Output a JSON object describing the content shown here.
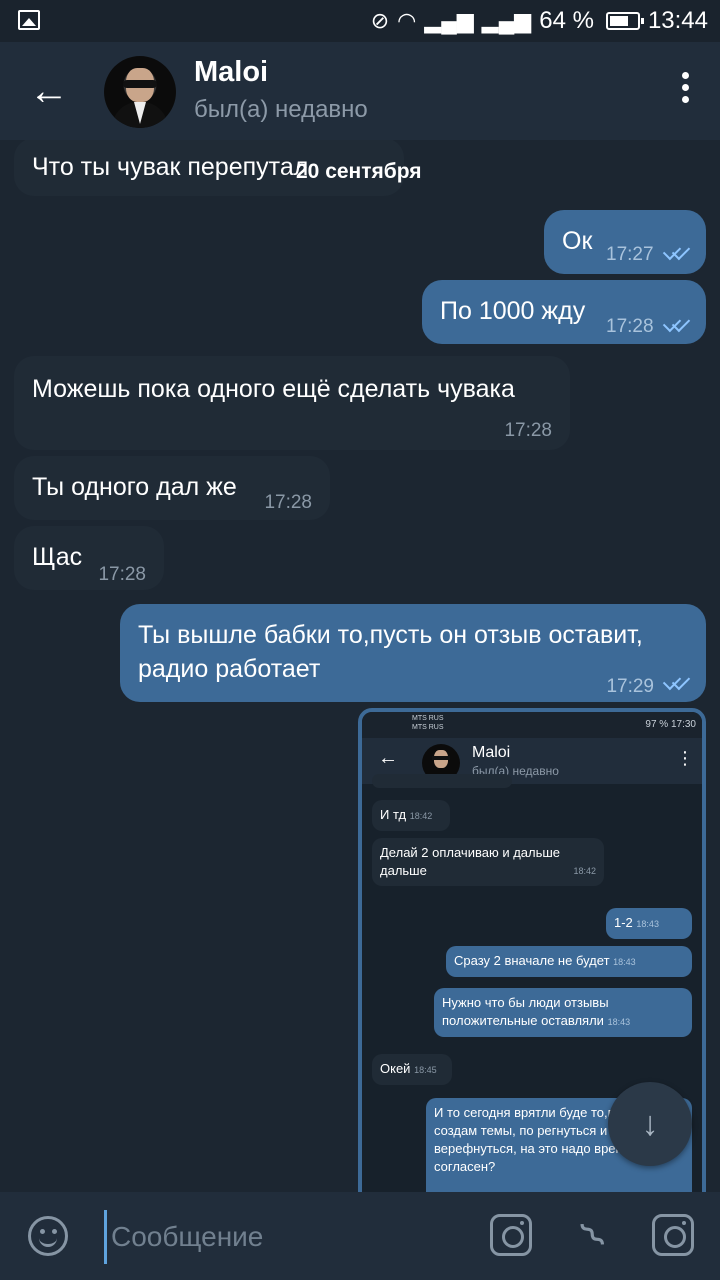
{
  "status_bar": {
    "battery": "64 %",
    "time": "13:44"
  },
  "header": {
    "title": "Maloi",
    "status": "был(а) недавно"
  },
  "date_separator": "20 сентября",
  "messages": [
    {
      "dir": "in",
      "text": "Что ты чувак перепутал",
      "time": ""
    },
    {
      "dir": "out",
      "text": "Ок",
      "time": "17:27"
    },
    {
      "dir": "out",
      "text": "По 1000 жду",
      "time": "17:28"
    },
    {
      "dir": "in",
      "text": "Можешь пока одного ещё сделать чувака",
      "time": "17:28"
    },
    {
      "dir": "in",
      "text": "Ты одного дал же",
      "time": "17:28"
    },
    {
      "dir": "in",
      "text": "Щас",
      "time": "17:28"
    },
    {
      "dir": "out",
      "text": "Ты вышле бабки то,пусть он отзыв оставит, радио работает",
      "time": "17:29"
    }
  ],
  "photo": {
    "status_left": "MTS RUS\nMTS RUS",
    "status_right": "97 % 17:30",
    "title": "Maloi",
    "status": "был(а) недавно",
    "messages": [
      {
        "dir": "in",
        "text": "И тд",
        "time": "18:42"
      },
      {
        "dir": "in",
        "text": "Делай 2 оплачиваю и дальше дальше",
        "time": "18:42"
      },
      {
        "dir": "out",
        "text": "1-2",
        "time": "18:43"
      },
      {
        "dir": "out",
        "text": "Сразу 2 вначале не будет",
        "time": "18:43"
      },
      {
        "dir": "out",
        "text": "Нужно что бы люди отзывы положительные оставляли",
        "time": "18:43"
      },
      {
        "dir": "in",
        "text": "Окей",
        "time": "18:45"
      },
      {
        "dir": "out",
        "text": "И то сегодня врятли буде то,пока я создам темы, по регнуться и верефнуться, на это надо время, согласен?",
        "time": ""
      }
    ]
  },
  "input": {
    "placeholder": "Сообщение"
  },
  "icons": {
    "back": "arrow-left-icon",
    "menu": "more-vertical-icon",
    "emoji": "smile-icon",
    "camera": "camera-icon",
    "attach": "paperclip-icon",
    "scroll": "arrow-down-icon"
  }
}
